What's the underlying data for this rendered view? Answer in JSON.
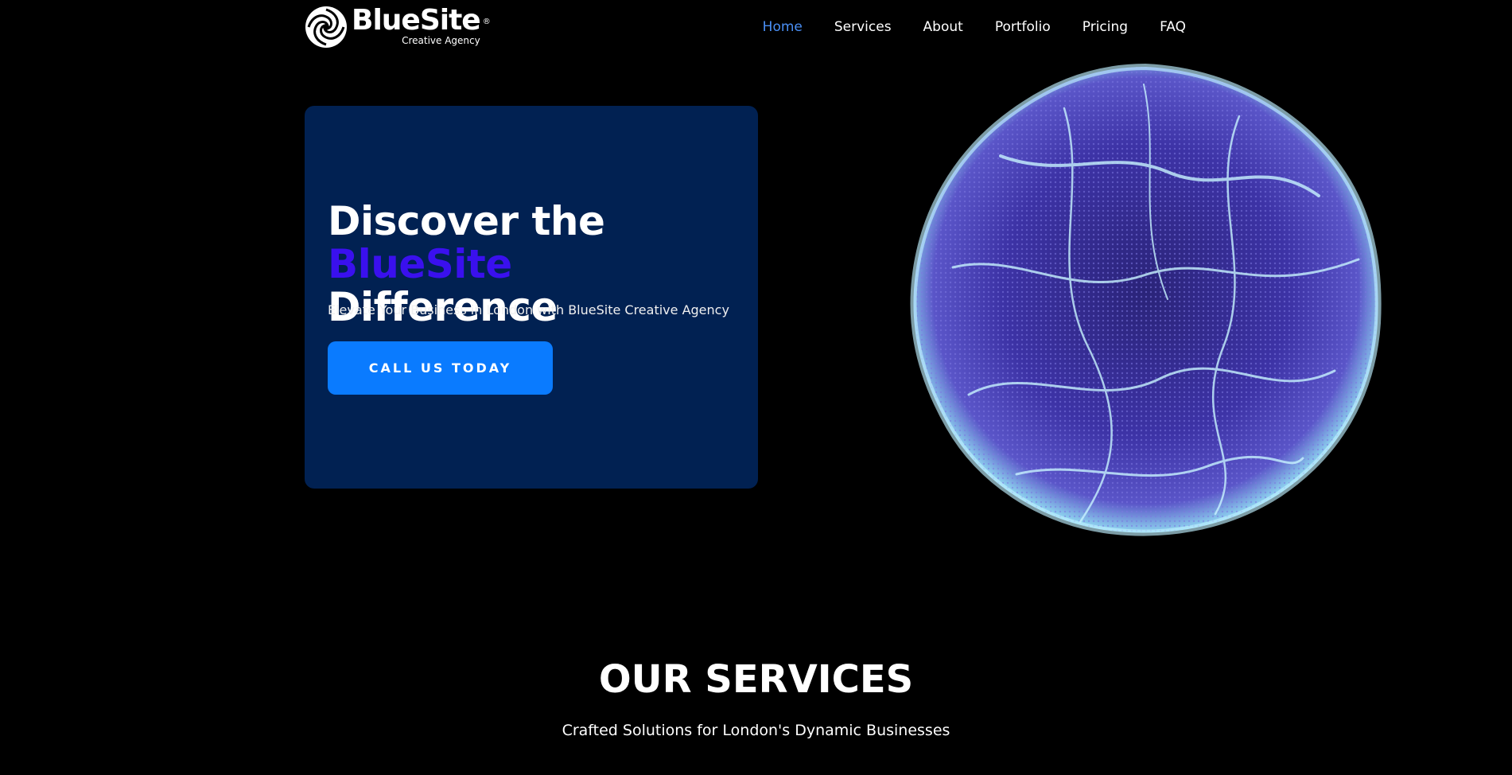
{
  "brand": {
    "name": "BlueSite",
    "registered": "®",
    "tagline": "Creative Agency"
  },
  "nav": {
    "items": [
      {
        "label": "Home",
        "active": true
      },
      {
        "label": "Services",
        "active": false
      },
      {
        "label": "About",
        "active": false
      },
      {
        "label": "Portfolio",
        "active": false
      },
      {
        "label": "Pricing",
        "active": false
      },
      {
        "label": "FAQ",
        "active": false
      }
    ]
  },
  "hero": {
    "title_line1": "Discover the",
    "title_accent": "BlueSite",
    "title_line2_rest": " Difference",
    "subtitle": "Elevate Your Business in London with BlueSite Creative Agency",
    "cta_label": "CALL US TODAY"
  },
  "services": {
    "title": "OUR SERVICES",
    "subtitle": "Crafted Solutions for London's Dynamic Businesses"
  },
  "colors": {
    "background": "#000000",
    "card": "#012152",
    "accent_text": "#3a10ee",
    "cta": "#0a7bff",
    "nav_active": "#4a8ff5",
    "orb": "#4b3fb8"
  },
  "icons": {
    "logo": "swirl-logo-icon",
    "orb": "energy-sphere-graphic"
  }
}
